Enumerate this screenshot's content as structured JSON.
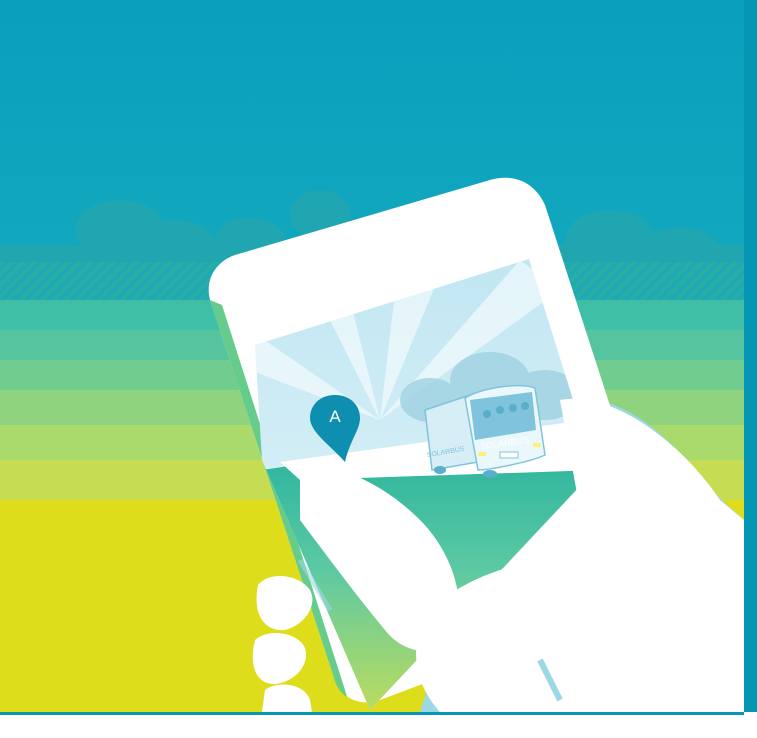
{
  "illustration": {
    "pin_letter": "A",
    "bus_label": "SOLARBUS",
    "bus_side_label": "SOLARBUS"
  },
  "colors": {
    "sky": "#0aa3bf",
    "sky_light": "#32b6c9",
    "band1": "#4fc3b0",
    "band2": "#5cc9a3",
    "band3": "#79d08c",
    "band4": "#9ed678",
    "band5": "#c2dd5a",
    "ground": "#dedd1c",
    "border": "#0596b4",
    "phone": "#ffffff",
    "hand_shadow": "#9cd7e6"
  },
  "icons": [
    "location-pin-icon",
    "bus-icon",
    "phone-icon",
    "hand-icon"
  ]
}
